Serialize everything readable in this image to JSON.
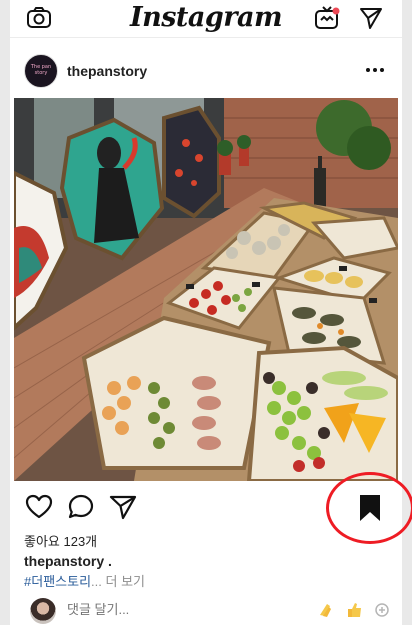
{
  "topbar": {
    "logo_text": "Instagram",
    "icons": [
      "camera-icon",
      "igtv-icon",
      "direct-message-icon"
    ]
  },
  "post": {
    "username": "thepanstory",
    "avatar_text_1": "The pan story",
    "avatar_text_2": "",
    "likes": "좋아요 123개",
    "caption_user": "thepanstory .",
    "caption_hashtag": "#더팬스토리",
    "caption_ellipsis": "...",
    "more_label": "더 보기",
    "comment_placeholder": "댓글 달기...",
    "action_icons": [
      "heart-icon",
      "comment-icon",
      "share-icon",
      "bookmark-icon"
    ]
  },
  "colors": {
    "annotation": "#ee1c24",
    "hashtag": "#2a5c9a",
    "muted": "#8e8e8e"
  }
}
